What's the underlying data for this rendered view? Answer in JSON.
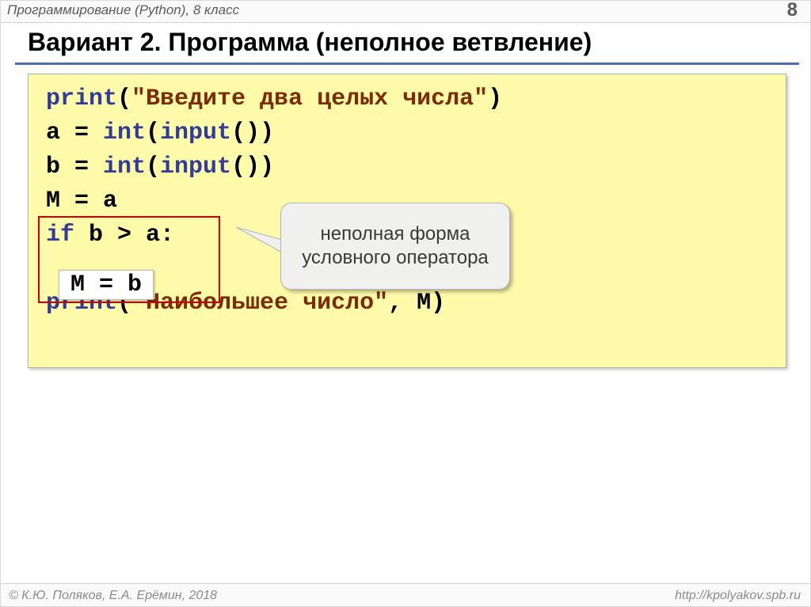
{
  "header": {
    "course": "Программирование (Python), 8 класс",
    "page": "8"
  },
  "title": "Вариант 2. Программа (неполное ветвление)",
  "code": {
    "l1_print": "print",
    "l1_open": "(",
    "l1_str": "\"Введите два целых числа\"",
    "l1_close": ")",
    "l2_a": "a = ",
    "l2_int": "int",
    "l2_open": "(",
    "l2_input": "input",
    "l2_paren": "())",
    "l3_b": "b = ",
    "l3_int": "int",
    "l3_open": "(",
    "l3_input": "input",
    "l3_paren": "())",
    "l4": "M = a",
    "l5_if": "if",
    "l5_cond": " b > a:",
    "l6_body": "M = b",
    "l7_print": "print",
    "l7_open": "(",
    "l7_str": "\"Наибольшее число\"",
    "l7_rest": ", M)"
  },
  "callout": "неполная форма условного оператора",
  "footer": {
    "left": "© К.Ю. Поляков, Е.А. Ерёмин, 2018",
    "right": "http://kpolyakov.spb.ru"
  }
}
